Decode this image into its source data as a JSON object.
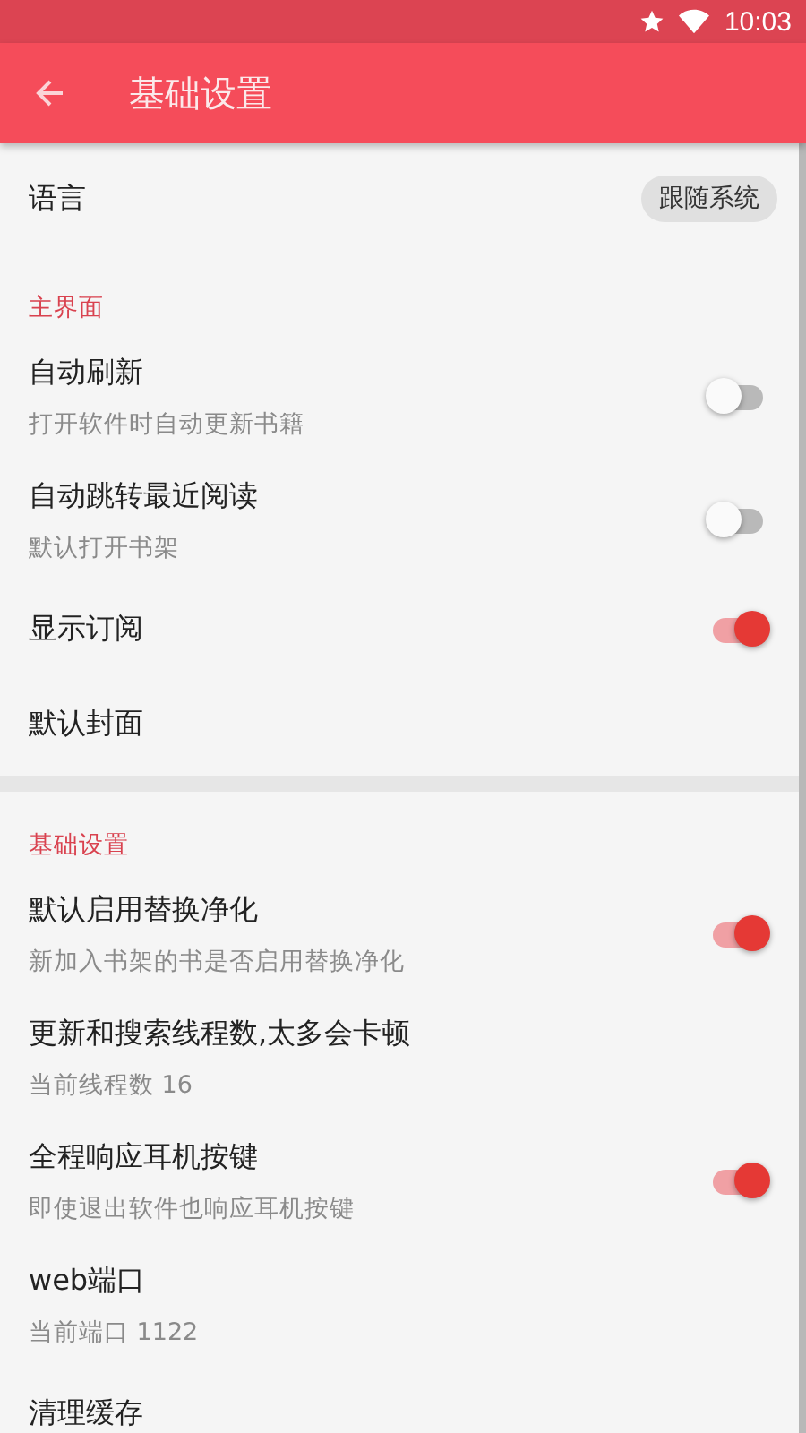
{
  "status_bar": {
    "time": "10:03"
  },
  "toolbar": {
    "title": "基础设置"
  },
  "sections": [
    {
      "items": [
        {
          "kind": "chip",
          "title": "语言",
          "value": "跟随系统"
        }
      ]
    },
    {
      "header": "主界面",
      "items": [
        {
          "kind": "switch",
          "title": "自动刷新",
          "summary": "打开软件时自动更新书籍",
          "on": false
        },
        {
          "kind": "switch",
          "title": "自动跳转最近阅读",
          "summary": "默认打开书架",
          "on": false
        },
        {
          "kind": "switch",
          "title": "显示订阅",
          "on": true
        },
        {
          "kind": "plain",
          "title": "默认封面"
        }
      ]
    },
    {
      "header": "基础设置",
      "items": [
        {
          "kind": "switch",
          "title": "默认启用替换净化",
          "summary": "新加入书架的书是否启用替换净化",
          "on": true
        },
        {
          "kind": "plain",
          "title": "更新和搜索线程数,太多会卡顿",
          "summary": "当前线程数 16"
        },
        {
          "kind": "switch",
          "title": "全程响应耳机按键",
          "summary": "即使退出软件也响应耳机按键",
          "on": true
        },
        {
          "kind": "plain",
          "title": "web端口",
          "summary": "当前端口 1122"
        },
        {
          "kind": "plain",
          "title": "清理缓存"
        }
      ]
    }
  ]
}
